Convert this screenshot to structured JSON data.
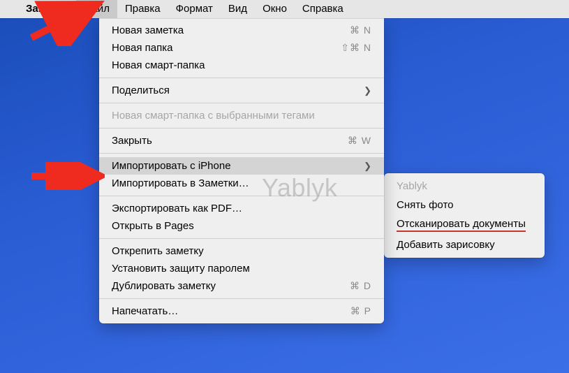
{
  "menubar": {
    "app": "Заметки",
    "items": [
      "Файл",
      "Правка",
      "Формат",
      "Вид",
      "Окно",
      "Справка"
    ]
  },
  "dropdown": {
    "new_note": "Новая заметка",
    "new_note_sc": "⌘ N",
    "new_folder": "Новая папка",
    "new_folder_sc": "⇧⌘ N",
    "new_smart": "Новая смарт-папка",
    "share": "Поделиться",
    "smart_tags": "Новая смарт-папка с выбранными тегами",
    "close": "Закрыть",
    "close_sc": "⌘ W",
    "import_iphone": "Импортировать с iPhone",
    "import_notes": "Импортировать в Заметки…",
    "export_pdf": "Экспортировать как PDF…",
    "open_pages": "Открыть в Pages",
    "unpin": "Открепить заметку",
    "set_password": "Установить защиту паролем",
    "duplicate": "Дублировать заметку",
    "duplicate_sc": "⌘ D",
    "print": "Напечатать…",
    "print_sc": "⌘ P"
  },
  "submenu": {
    "device": "Yablyk",
    "take_photo": "Снять фото",
    "scan_docs": "Отсканировать документы",
    "add_sketch": "Добавить зарисовку"
  },
  "watermark": "Yablyk"
}
